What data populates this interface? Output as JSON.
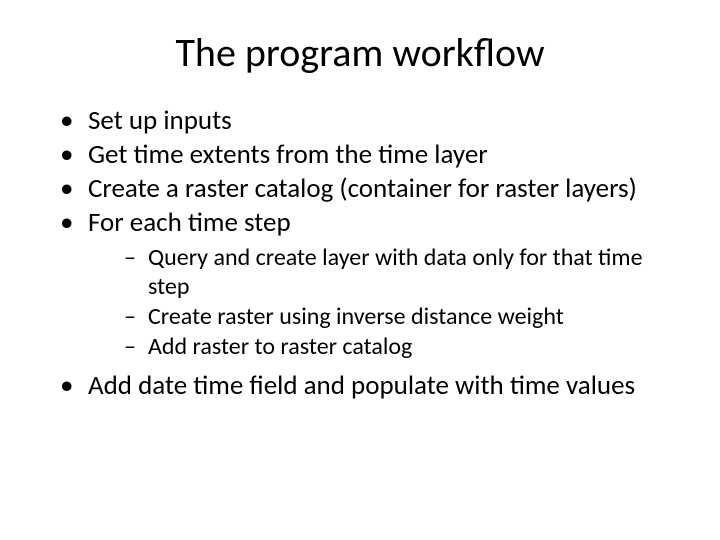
{
  "title": "The program workflow",
  "bullets": {
    "b1": "Set up inputs",
    "b2": "Get time extents from the time layer",
    "b3": "Create a raster catalog (container for raster layers)",
    "b4": "For each time step",
    "b4_sub": {
      "s1": "Query and create layer with data only for that time step",
      "s2": "Create raster using inverse distance weight",
      "s3": "Add raster to raster catalog"
    },
    "b5": "Add date time field and populate with time values"
  }
}
